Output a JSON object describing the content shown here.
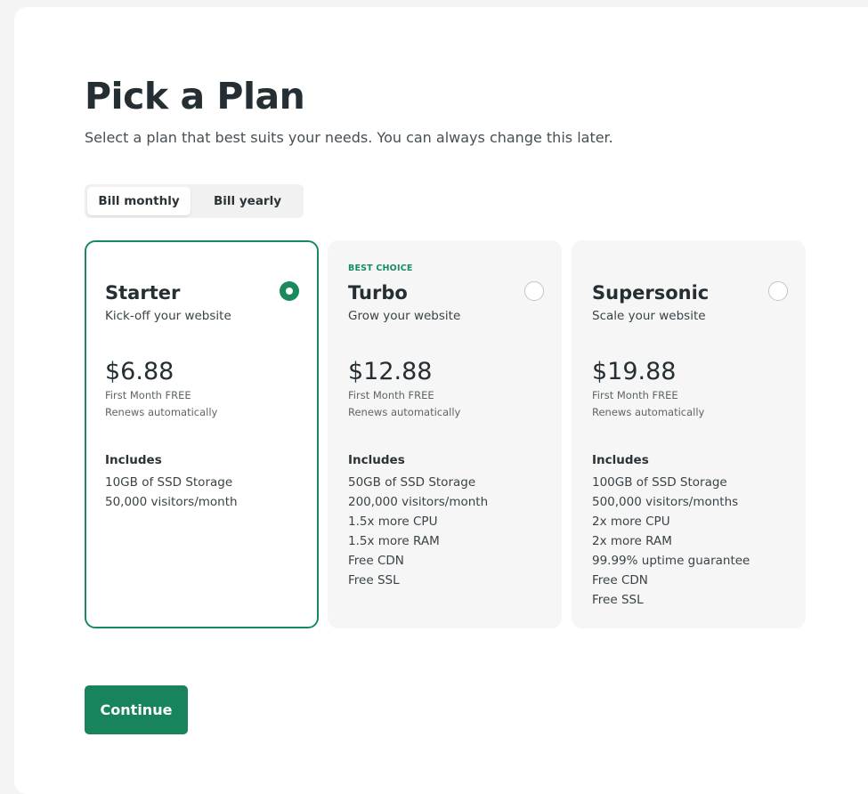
{
  "header": {
    "title": "Pick a Plan",
    "subtitle": "Select a plan that best suits your needs. You can always change this later."
  },
  "billing": {
    "options": [
      "Bill monthly",
      "Bill yearly"
    ],
    "selected": "Bill monthly"
  },
  "plans": [
    {
      "badge": "",
      "name": "Starter",
      "tagline": "Kick-off your website",
      "price": "$6.88",
      "note_first": "First Month FREE",
      "note_renew": "Renews automatically",
      "includes_label": "Includes",
      "features": [
        "10GB of SSD Storage",
        "50,000 visitors/month"
      ],
      "selected": true
    },
    {
      "badge": "BEST CHOICE",
      "name": "Turbo",
      "tagline": "Grow your website",
      "price": "$12.88",
      "note_first": "First Month FREE",
      "note_renew": "Renews automatically",
      "includes_label": "Includes",
      "features": [
        "50GB of SSD Storage",
        "200,000 visitors/month",
        "1.5x more CPU",
        "1.5x more RAM",
        "Free CDN",
        "Free SSL"
      ],
      "selected": false
    },
    {
      "badge": "",
      "name": "Supersonic",
      "tagline": "Scale your website",
      "price": "$19.88",
      "note_first": "First Month FREE",
      "note_renew": "Renews automatically",
      "includes_label": "Includes",
      "features": [
        "100GB of SSD Storage",
        "500,000 visitors/months",
        "2x more CPU",
        "2x more RAM",
        "99.99% uptime guarantee",
        "Free CDN",
        "Free SSL"
      ],
      "selected": false
    }
  ],
  "actions": {
    "continue_label": "Continue"
  },
  "colors": {
    "accent": "#1a8a5e",
    "button": "#17845b",
    "badge": "#178d5f",
    "text": "#252e33"
  }
}
